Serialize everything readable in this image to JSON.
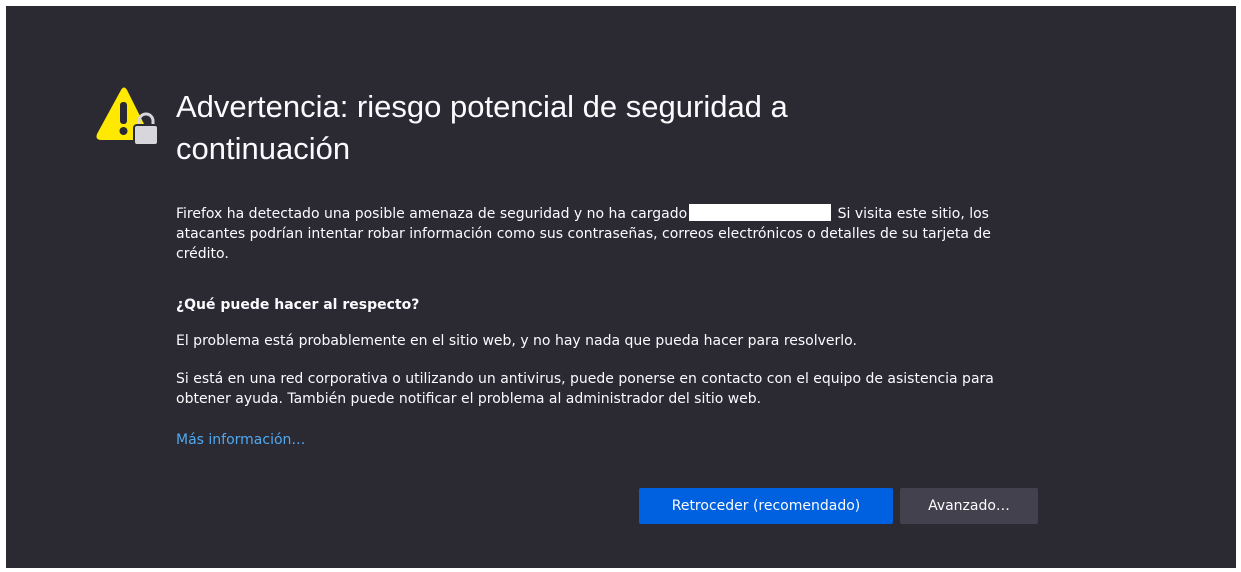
{
  "error_page": {
    "title": "Advertencia: riesgo potencial de seguridad a continuación",
    "intro_before": "Firefox ha detectado una posible amenaza de seguridad y no ha cargado",
    "intro_after": "Si visita este sitio, los atacantes podrían intentar robar información como sus contraseñas, correos electrónicos o detalles de su tarjeta de crédito.",
    "what_heading": "¿Qué puede hacer al respecto?",
    "para_problem": "El problema está probablemente en el sitio web, y no hay nada que pueda hacer para resolverlo.",
    "para_corporate": "Si está en una red corporativa o utilizando un antivirus, puede ponerse en contacto con el equipo de asistencia para obtener ayuda. También puede notificar el problema al administrador del sitio web.",
    "learn_more": "Más información…",
    "back_button": "Retroceder (recomendado)",
    "advanced_button": "Avanzado…",
    "icon": "warning-lock-icon"
  },
  "colors": {
    "background": "#2b2a33",
    "text": "#fbfbfe",
    "link": "#4fa8f0",
    "primary_button": "#0061e0",
    "secondary_button": "#42414d",
    "warning_yellow": "#ffe900"
  }
}
